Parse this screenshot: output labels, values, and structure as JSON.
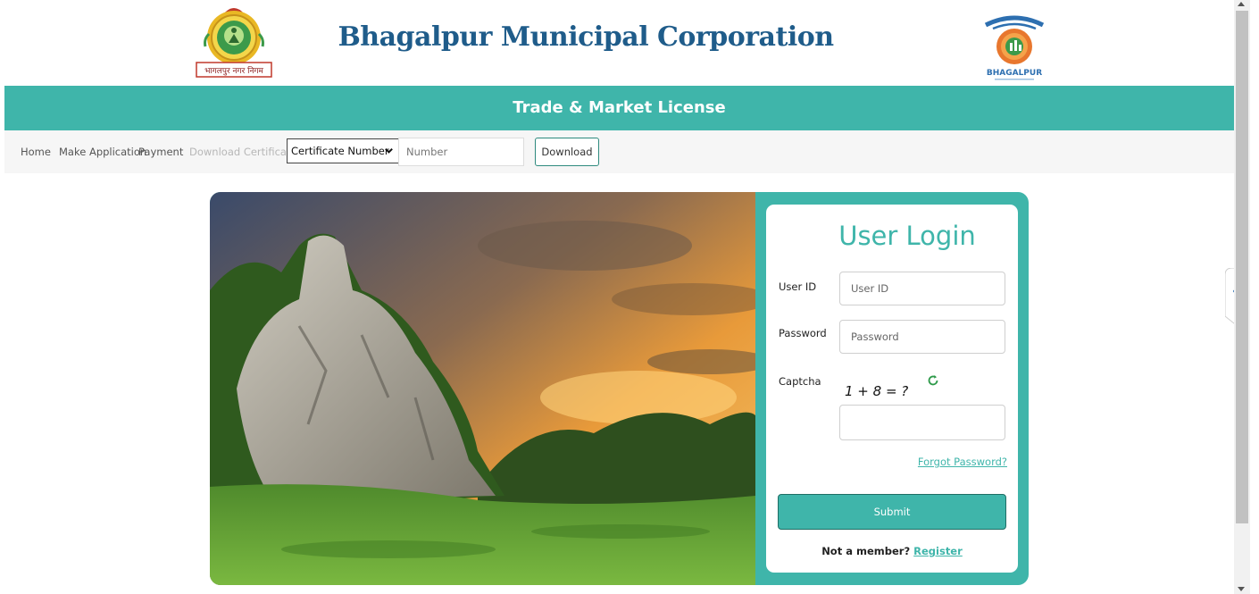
{
  "header": {
    "title": "Bhagalpur Municipal Corporation",
    "left_logo_text": "भागलपुर नगर निगम",
    "right_logo_text": "BHAGALPUR"
  },
  "banner": {
    "title": "Trade & Market License"
  },
  "nav": {
    "home": "Home",
    "make_application": "Make Application",
    "payment": "Payment",
    "download_certificate": "Download Certificate",
    "select_value": "Certificate Number",
    "number_placeholder": "Number",
    "download_button": "Download"
  },
  "login": {
    "title": "User Login",
    "user_id_label": "User ID",
    "user_id_placeholder": "User ID",
    "password_label": "Password",
    "password_placeholder": "Password",
    "captcha_label": "Captcha",
    "captcha_question": "1 + 8 = ?",
    "forgot_password": "Forgot Password?",
    "submit": "Submit",
    "not_member": "Not a member?",
    "register": "Register"
  },
  "colors": {
    "accent": "#3fb5aa",
    "title_blue": "#1f5c8a",
    "nav_bg": "#f6f6f6"
  },
  "icons": [
    "refresh-icon",
    "chevron-down-icon",
    "chevron-left-icon"
  ]
}
